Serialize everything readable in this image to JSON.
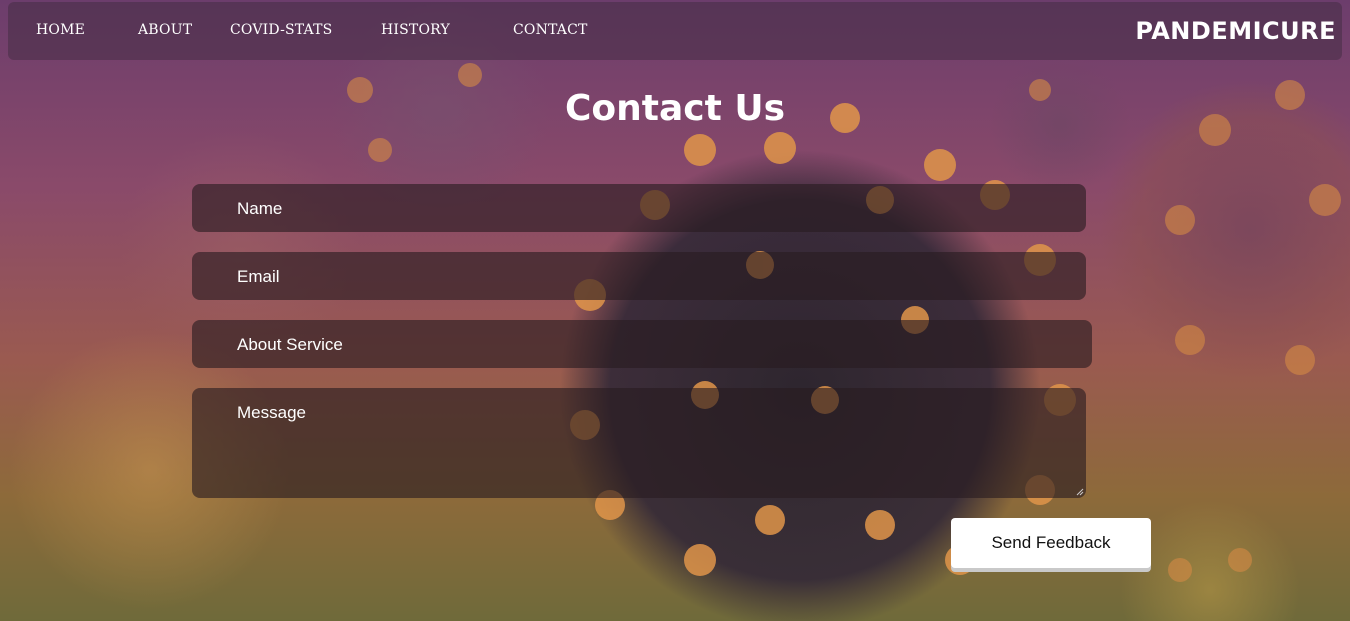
{
  "nav": {
    "items": [
      {
        "label": "HOME"
      },
      {
        "label": "ABOUT"
      },
      {
        "label": "COVID-STATS"
      },
      {
        "label": "HISTORY"
      },
      {
        "label": "CONTACT"
      }
    ],
    "brand": "PANDEMICURE"
  },
  "page": {
    "title": "Contact Us"
  },
  "form": {
    "name_placeholder": "Name",
    "email_placeholder": "Email",
    "service_placeholder": "About Service",
    "message_placeholder": "Message",
    "submit_label": "Send Feedback"
  },
  "colors": {
    "background_top": "#6c3d6c",
    "background_bottom": "#6f6a3a",
    "text": "#ffffff",
    "button_bg": "#ffffff"
  }
}
